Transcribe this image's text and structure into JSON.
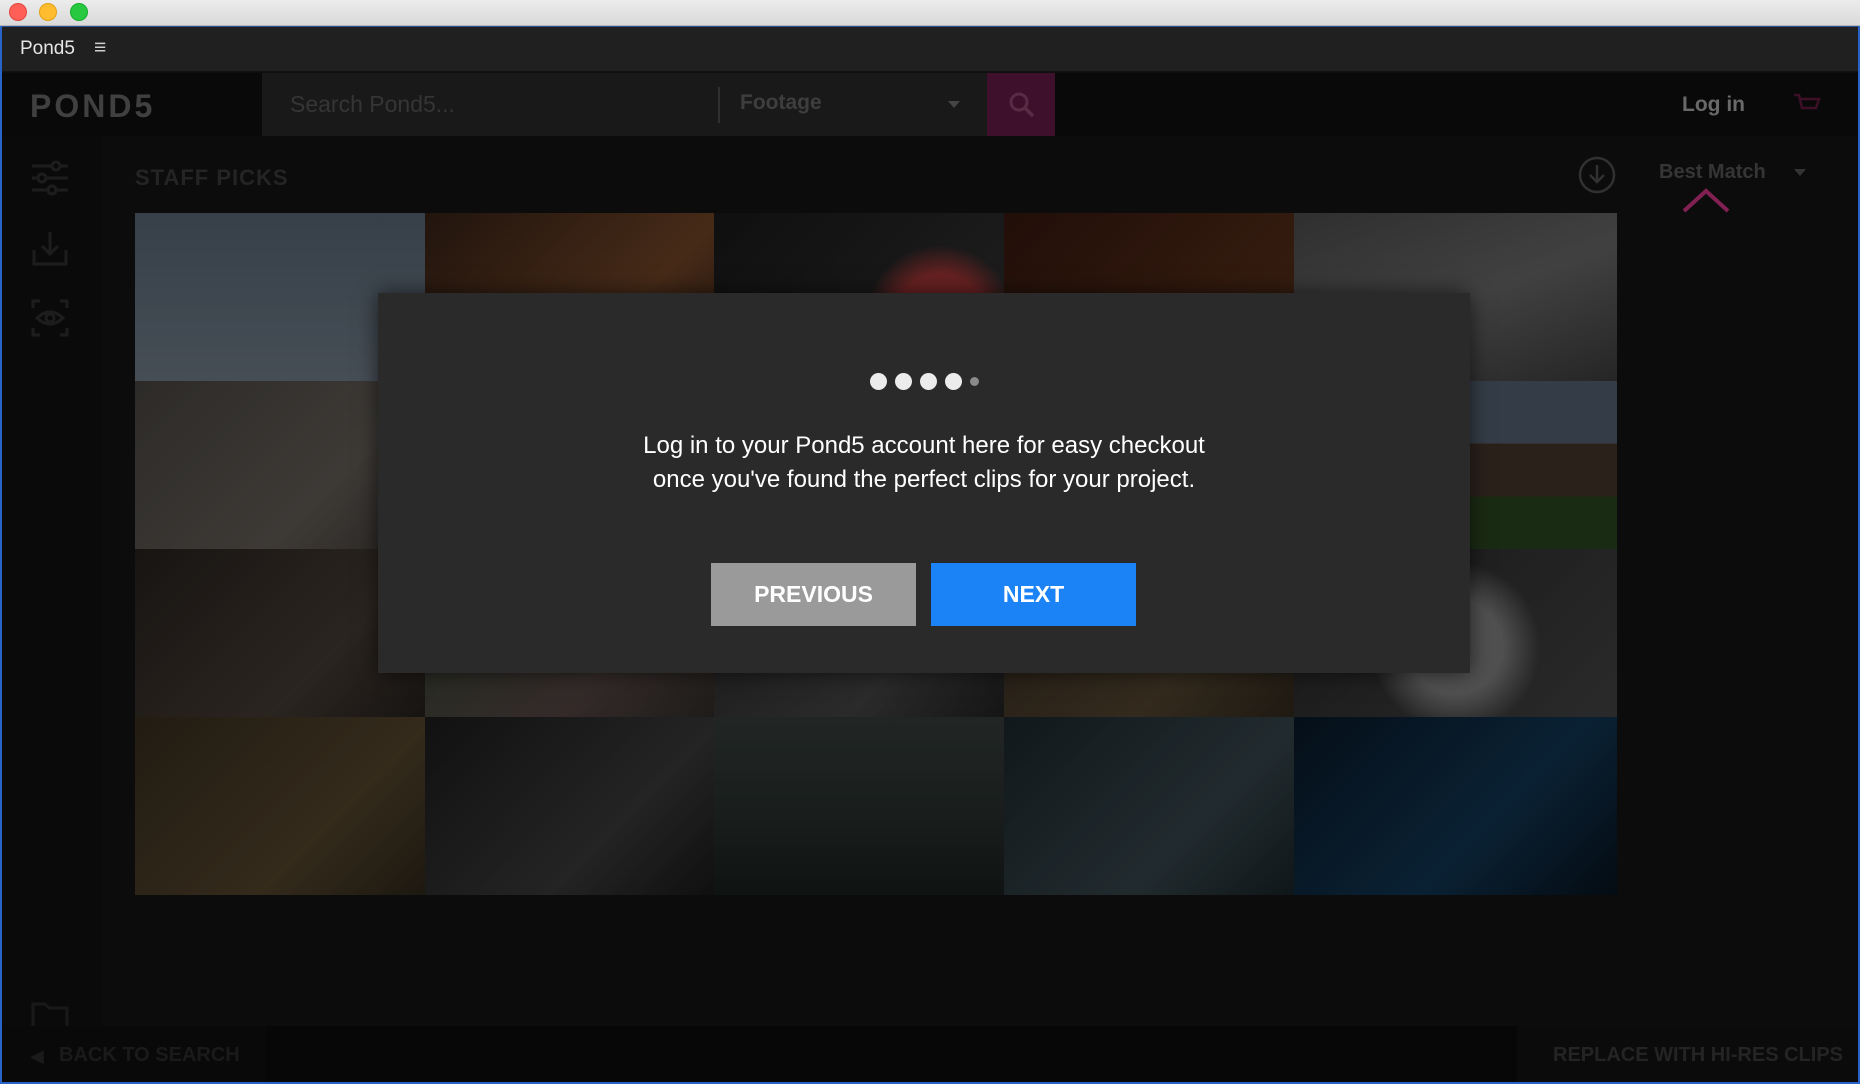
{
  "window": {
    "panel_title": "Pond5",
    "panel_menu_icon": "≡"
  },
  "header": {
    "logo": "POND5",
    "search_placeholder": "Search Pond5...",
    "category": "Footage",
    "login_label": "Log in"
  },
  "content": {
    "section_title": "STAFF PICKS",
    "sort_label": "Best Match"
  },
  "bottom": {
    "back_label": "BACK TO SEARCH",
    "replace_label": "REPLACE WITH HI-RES CLIPS"
  },
  "modal": {
    "progress": {
      "current": 5,
      "total": 5
    },
    "message_line1": "Log in to your Pond5 account here for easy checkout",
    "message_line2": "once you've found the perfect clips for your project.",
    "previous_label": "PREVIOUS",
    "next_label": "NEXT"
  },
  "colors": {
    "accent_magenta": "#e0368f",
    "next_button": "#1b83f5",
    "previous_button": "#9a9a9a",
    "modal_bg": "#2a2a2a"
  },
  "thumbnails": [
    {
      "subject": "eagle in flight"
    },
    {
      "subject": "city building"
    },
    {
      "subject": "motorcycle"
    },
    {
      "subject": "wooden interior"
    },
    {
      "subject": "rocky terrain"
    },
    {
      "subject": "man talking"
    },
    {
      "subject": "house exterior"
    },
    {
      "subject": "man with phone"
    },
    {
      "subject": "couple smiling"
    },
    {
      "subject": "laptop typing"
    },
    {
      "subject": "construction worker"
    },
    {
      "subject": "cat figurines"
    },
    {
      "subject": "cat on counter"
    },
    {
      "subject": "graduation caps"
    },
    {
      "subject": "stormy trees"
    },
    {
      "subject": "face with glasses"
    },
    {
      "subject": "digital grid"
    }
  ]
}
